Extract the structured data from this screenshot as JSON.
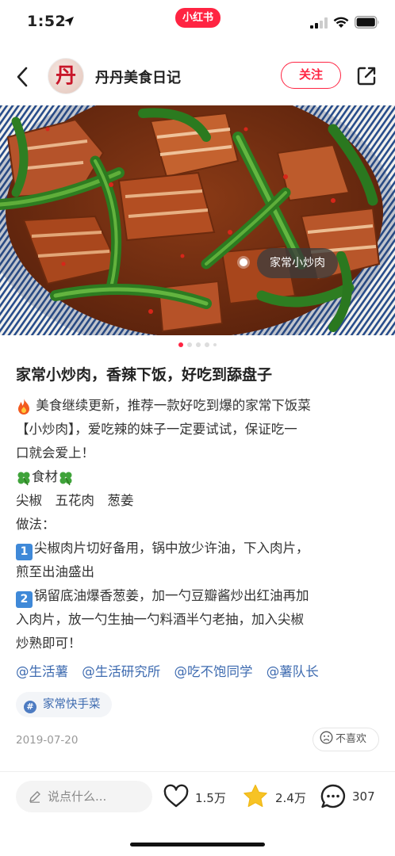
{
  "status_bar": {
    "time": "1:52",
    "app_badge": "小红书"
  },
  "header": {
    "author_name": "丹丹美食日记",
    "avatar_char": "丹",
    "follow_label": "关注"
  },
  "hero": {
    "image_tag": "家常小炒肉",
    "carousel_total": 5,
    "carousel_active": 1
  },
  "note": {
    "title": "家常小炒肉，香辣下饭，好吃到舔盘子",
    "body_lines": [
      "美食继续更新，推荐一款好吃到爆的家常下饭菜",
      "【小炒肉】，爱吃辣的妹子一定要试试，保证吃一",
      "口就会爱上！",
      "食材",
      "尖椒　五花肉　葱姜",
      "做法：",
      "尖椒肉片切好备用，锅中放少许油，下入肉片，",
      "煎至出油盛出",
      "锅留底油爆香葱姜，加一勺豆瓣酱炒出红油再加",
      "入肉片，放一勺生抽一勺料酒半勺老抽，加入尖椒",
      "炒熟即可！"
    ],
    "step_numbers": [
      "1",
      "2"
    ],
    "mentions": [
      "@生活薯",
      "@生活研究所",
      "@吃不饱同学",
      "@薯队长"
    ],
    "topic": "家常快手菜",
    "date": "2019-07-20",
    "dislike_label": "不喜欢"
  },
  "bottom_bar": {
    "comment_placeholder": "说点什么...",
    "like_count": "1.5万",
    "collect_count": "2.4万",
    "comment_count": "307"
  },
  "colors": {
    "brand": "#ff2442",
    "link": "#3e6bb0",
    "star": "#f7c325"
  },
  "icons": [
    "location-arrow-icon",
    "signal-icon",
    "wifi-icon",
    "battery-icon",
    "back-icon",
    "share-icon",
    "fire-icon",
    "clover-icon",
    "hash-icon",
    "frown-icon",
    "pencil-icon",
    "heart-icon",
    "star-icon",
    "comment-bubble-icon"
  ]
}
